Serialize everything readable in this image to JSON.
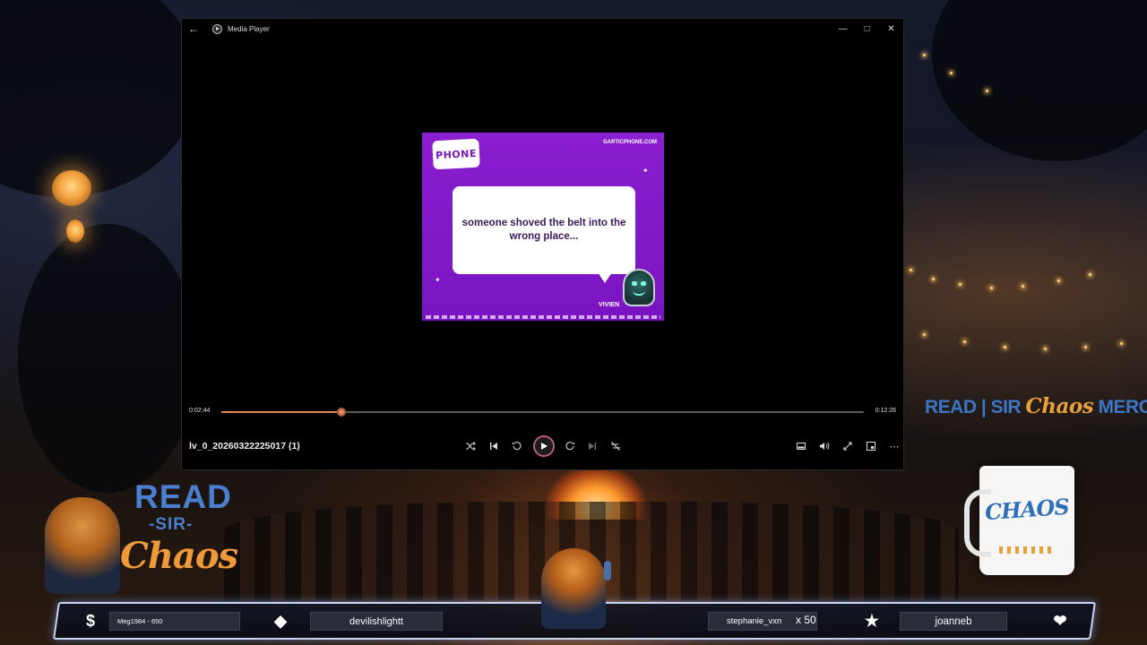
{
  "player": {
    "title": "Media Player",
    "time_current": "0:02:44",
    "time_total": "0:12:26",
    "progress": 0.187,
    "file_name": "lv_0_20260322225017 (1)"
  },
  "video": {
    "logo_text": "PHONE",
    "site": "GARTICPHONE.COM",
    "caption": "someone shoved the belt into the wrong place...",
    "player_name": "VIVIEN"
  },
  "overlay": {
    "merch_read": "READ",
    "merch_sir": "SIR",
    "merch_chaos": "Chaos",
    "merch_word": "MERCH",
    "mug_text": "CHAOS",
    "brand_read": "READ",
    "brand_sir": "-SIR-",
    "brand_chaos": "Chaos"
  },
  "bottombar": {
    "donation": "Meg1984 - 650",
    "gift": "devilishlightt",
    "bits_user": "stephanie_vxn",
    "bits_count": "x 50",
    "follower": "joanneb"
  },
  "colors": {
    "accent_orange": "#e8875d",
    "brand_blue": "#4a7fcf",
    "brand_orange": "#ef9a3a",
    "garticphone_purple": "#7a14c2"
  }
}
